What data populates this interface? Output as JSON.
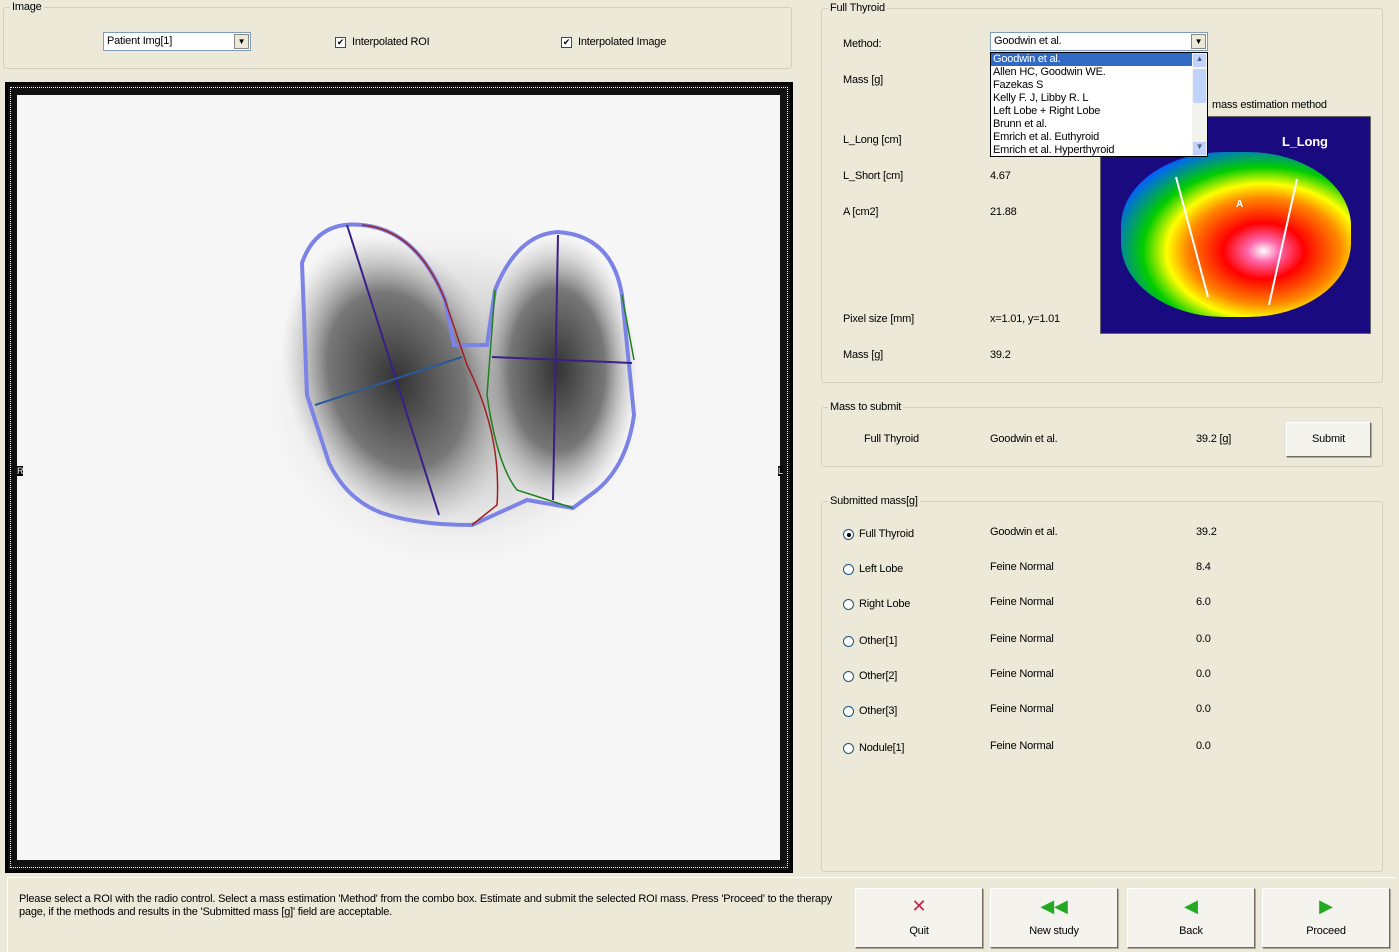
{
  "image_panel": {
    "title": "Image",
    "image_select": "Patient Img[1]",
    "interpolated_roi": {
      "label": "Interpolated ROI",
      "checked": true
    },
    "interpolated_image": {
      "label": "Interpolated Image",
      "checked": true
    },
    "marker_left": "R",
    "marker_right": "L"
  },
  "full_thyroid": {
    "title": "Full Thyroid",
    "method_label": "Method:",
    "method_value": "Goodwin et al.",
    "mass_label": "Mass [g]",
    "l_long_label": "L_Long [cm]",
    "l_short_label": "L_Short [cm]",
    "l_short_value": "4.67",
    "a_label": "A [cm2]",
    "a_value": "21.88",
    "pixel_label": "Pixel size [mm]",
    "pixel_value": "x=1.01, y=1.01",
    "mass2_label": "Mass [g]",
    "mass2_value": "39.2",
    "illustration_caption": "mass estimation method",
    "illustration_l_long": "L_Long",
    "illustration_a": "A",
    "dropdown_options": [
      "Goodwin et al.",
      "Allen HC, Goodwin WE.",
      "Fazekas S",
      "Kelly F. J, Libby R. L",
      "Left Lobe + Right Lobe",
      "Brunn et al.",
      "Emrich et al. Euthyroid",
      "Emrich et al. Hyperthyroid"
    ]
  },
  "mass_to_submit": {
    "title": "Mass to submit",
    "roi": "Full Thyroid",
    "method": "Goodwin et al.",
    "mass": "39.2 [g]",
    "submit": "Submit"
  },
  "submitted": {
    "title": "Submitted mass[g]",
    "rows": [
      {
        "roi": "Full Thyroid",
        "method": "Goodwin et al.",
        "mass": "39.2",
        "selected": true
      },
      {
        "roi": "Left Lobe",
        "method": "Feine Normal",
        "mass": "8.4",
        "selected": false
      },
      {
        "roi": "Right Lobe",
        "method": "Feine Normal",
        "mass": "6.0",
        "selected": false
      },
      {
        "roi": "Other[1]",
        "method": "Feine Normal",
        "mass": "0.0",
        "selected": false
      },
      {
        "roi": "Other[2]",
        "method": "Feine Normal",
        "mass": "0.0",
        "selected": false
      },
      {
        "roi": "Other[3]",
        "method": "Feine Normal",
        "mass": "0.0",
        "selected": false
      },
      {
        "roi": "Nodule[1]",
        "method": "Feine Normal",
        "mass": "0.0",
        "selected": false
      }
    ]
  },
  "footer": {
    "instructions": "Please select a ROI with the radio control. Select a mass estimation 'Method' from the combo box. Estimate and submit the selected ROI mass. Press 'Proceed' to the therapy page, if the methods and results in the 'Submitted mass [g]' field are acceptable.",
    "quit": "Quit",
    "new_study": "New study",
    "back": "Back",
    "proceed": "Proceed"
  },
  "colors": {
    "roi_outline": "#7b83e6",
    "selection": "#316ac5",
    "quit_icon": "#cc2244",
    "nav_icon": "#22aa22"
  }
}
